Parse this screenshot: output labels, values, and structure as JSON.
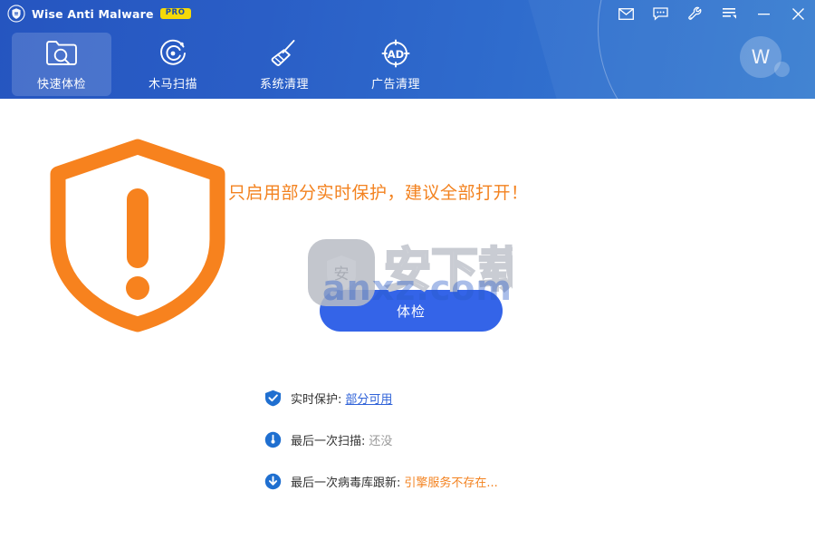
{
  "window": {
    "app_logo_icon": "shield-logo-icon",
    "title": "Wise Anti Malware",
    "pro_badge": "PRO",
    "controls": [
      {
        "name": "mail",
        "icon": "envelope-icon",
        "tooltip": "Feedback"
      },
      {
        "name": "chat",
        "icon": "chat-bubble-icon",
        "tooltip": "Support"
      },
      {
        "name": "tools",
        "icon": "wrench-icon",
        "tooltip": "Tools"
      },
      {
        "name": "menu",
        "icon": "list-menu-icon",
        "tooltip": "Menu"
      },
      {
        "name": "minimize",
        "icon": "minimize-icon",
        "tooltip": "Minimize"
      },
      {
        "name": "close",
        "icon": "close-icon",
        "tooltip": "Close"
      }
    ]
  },
  "nav": {
    "tabs": [
      {
        "label": "快速体检",
        "icon": "folder-search-icon",
        "active": true
      },
      {
        "label": "木马扫描",
        "icon": "radar-scan-icon",
        "active": false
      },
      {
        "label": "系统清理",
        "icon": "broom-icon",
        "active": false
      },
      {
        "label": "广告清理",
        "icon": "ad-circle-icon",
        "active": false
      }
    ]
  },
  "account": {
    "avatar_letter": "W"
  },
  "main": {
    "status_icon": "shield-exclamation-icon",
    "warning_message": "只启用部分实时保护，建议全部打开！",
    "scan_button": "体检",
    "status_items": [
      {
        "icon": "shield-check-icon",
        "label": "实时保护:",
        "value": "部分可用",
        "style": "link"
      },
      {
        "icon": "clock-icon",
        "label": "最后一次扫描:",
        "value": "还没",
        "style": "muted"
      },
      {
        "icon": "download-arrow-icon",
        "label": "最后一次病毒库跟新:",
        "value": "引擎服务不存在...",
        "style": "warn"
      }
    ]
  },
  "watermark": {
    "logo_char": "安",
    "text_cn": "安下载",
    "domain": "anxz.com"
  },
  "colors": {
    "header_start": "#2555c0",
    "header_end": "#3a7fd0",
    "accent_orange": "#f3821f",
    "accent_blue": "#3464e8",
    "link_blue": "#2f62d8",
    "badge_yellow": "#f5d908"
  }
}
